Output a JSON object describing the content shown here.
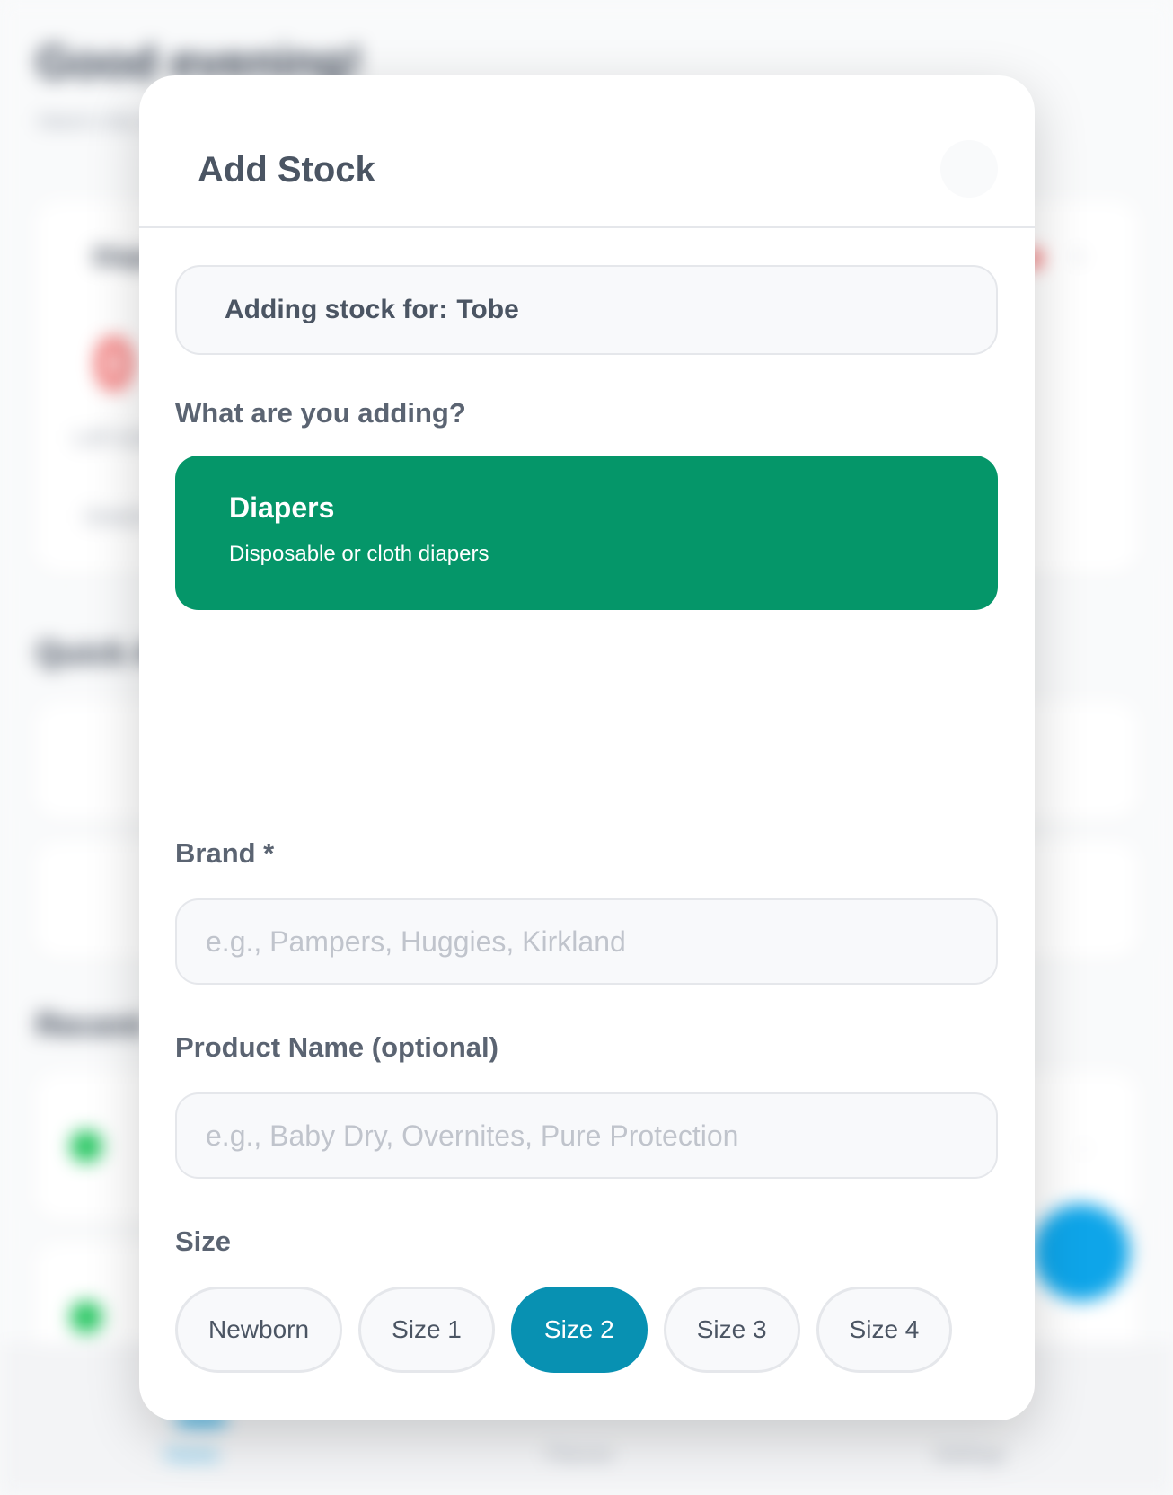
{
  "background": {
    "greeting": "Good evening!",
    "subtitle": "Here's the diaper status",
    "card_title": "Diaper stock",
    "big_number": "0",
    "left_label": "Left today",
    "left_link": "Details",
    "quick_actions_title": "Quick Actions",
    "recent_title": "Recent",
    "tabs": [
      "Home",
      "Planner",
      "Settings"
    ],
    "accent_color": "#0ea5e9"
  },
  "modal": {
    "title": "Add Stock",
    "close_icon": "close-icon",
    "adding_for_prefix": "Adding stock for:",
    "adding_for_name": "Tobe",
    "what_adding_label": "What are you adding?",
    "type_option": {
      "title": "Diapers",
      "description": "Disposable or cloth diapers",
      "color": "#059669"
    },
    "brand": {
      "label": "Brand *",
      "placeholder": "e.g., Pampers, Huggies, Kirkland",
      "value": ""
    },
    "product_name": {
      "label": "Product Name (optional)",
      "placeholder": "e.g., Baby Dry, Overnites, Pure Protection",
      "value": ""
    },
    "size": {
      "label": "Size",
      "options": [
        "Newborn",
        "Size 1",
        "Size 2",
        "Size 3",
        "Size 4"
      ],
      "selected": "Size 2",
      "selected_color": "#0891b2"
    }
  }
}
